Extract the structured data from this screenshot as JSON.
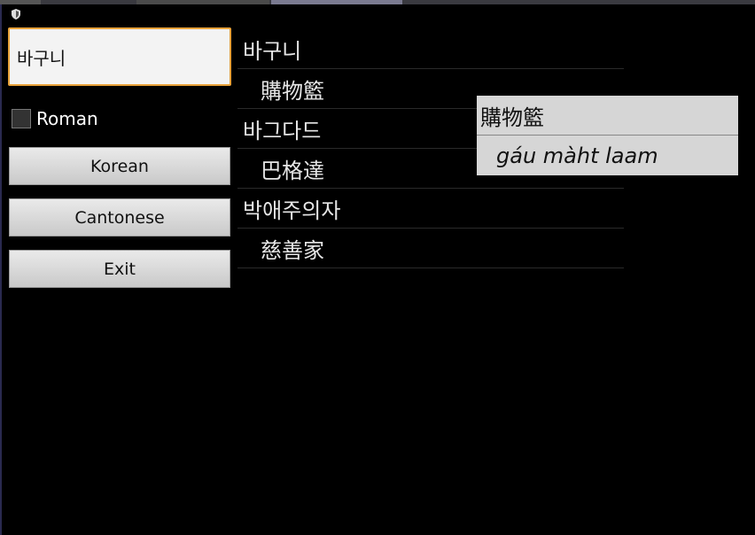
{
  "search": {
    "value": "바구니"
  },
  "roman_toggle": {
    "label": "Roman",
    "checked": false
  },
  "buttons": {
    "korean": "Korean",
    "cantonese": "Cantonese",
    "exit": "Exit"
  },
  "results": [
    {
      "korean": "바구니",
      "chinese": "購物籃"
    },
    {
      "korean": "바그다드",
      "chinese": "巴格達"
    },
    {
      "korean": "박애주의자",
      "chinese": "慈善家"
    }
  ],
  "popup": {
    "title": "購物籃",
    "romanization": "gáu màht laam"
  },
  "colors": {
    "accent_focus": "#e8a23a",
    "background": "#000000",
    "popup_bg": "#d6d6d6"
  },
  "icons": {
    "status": "shield-icon"
  }
}
